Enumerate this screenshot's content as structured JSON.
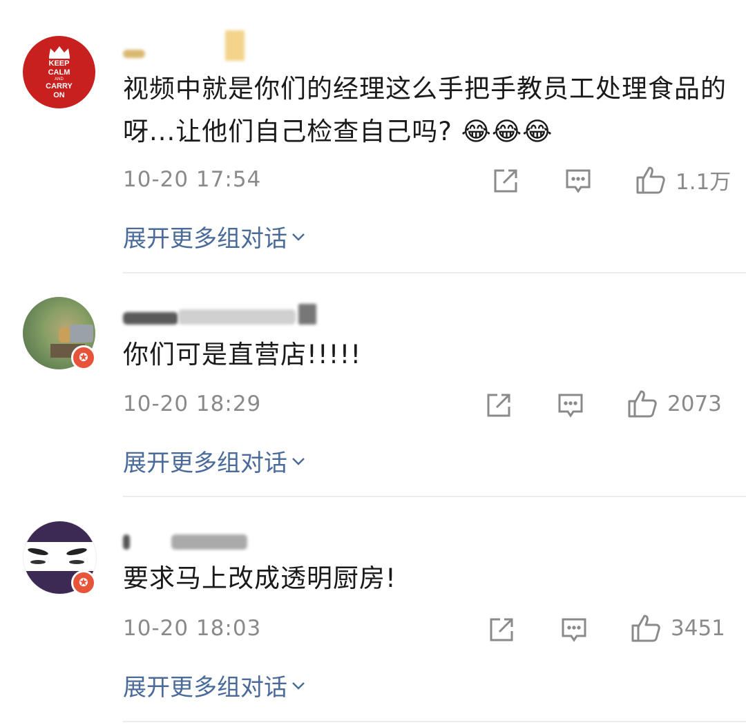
{
  "comments": [
    {
      "avatar_text": [
        "KEEP",
        "CALM",
        "AND",
        "CARRY",
        "ON"
      ],
      "text": "视频中就是你们的经理这么手把手教员工处理食品的呀...让他们自己检查自己吗? 😂😂😂",
      "time": "10-20 17:54",
      "likes": "1.1万",
      "expand": "展开更多组对话"
    },
    {
      "text": "你们可是直营店!!!!!",
      "time": "10-20 18:29",
      "likes": "2073",
      "expand": "展开更多组对话"
    },
    {
      "text": "要求马上改成透明厨房!",
      "time": "10-20 18:03",
      "likes": "3451",
      "expand": "展开更多组对话"
    }
  ],
  "colors": {
    "link": "#4a6a9a",
    "meta": "#8a8a8a",
    "badge": "#e8543a",
    "avatar1_bg": "#c8201e"
  },
  "icons": [
    "share-icon",
    "comment-icon",
    "like-icon",
    "chevron-down-icon",
    "vip-badge-icon"
  ]
}
